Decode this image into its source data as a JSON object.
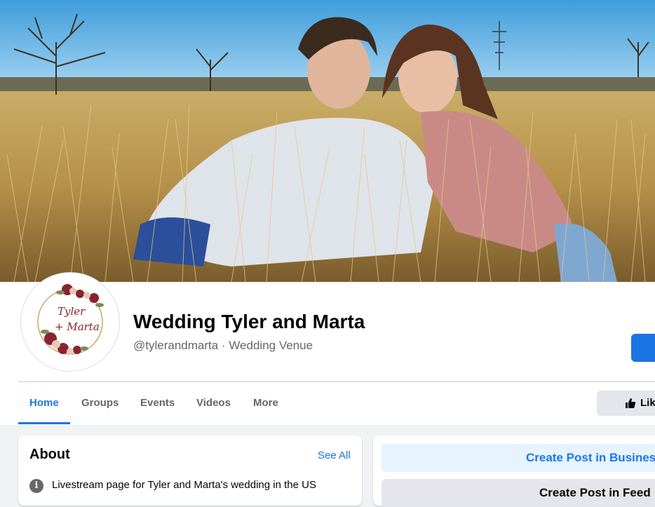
{
  "page": {
    "name": "Wedding Tyler and Marta",
    "handle": "@tylerandmarta",
    "separator": " · ",
    "category": "Wedding Venue"
  },
  "cover": {
    "description_icon": "cover-photo"
  },
  "avatar": {
    "script_line1": "Tyler",
    "script_line2": "+ Marta"
  },
  "nav": {
    "tabs": [
      {
        "label": "Home",
        "active": true
      },
      {
        "label": "Groups"
      },
      {
        "label": "Events"
      },
      {
        "label": "Videos"
      },
      {
        "label": "More"
      }
    ],
    "like_label": "Lik"
  },
  "about": {
    "title": "About",
    "see_all": "See All",
    "description": "Livestream page for Tyler and Marta's wedding in the US"
  },
  "posts": {
    "create_post_business": "Create Post in Business",
    "create_post_2": "Create Post in Feed"
  },
  "colors": {
    "accent": "#1b74e4",
    "background": "#f0f2f5"
  }
}
